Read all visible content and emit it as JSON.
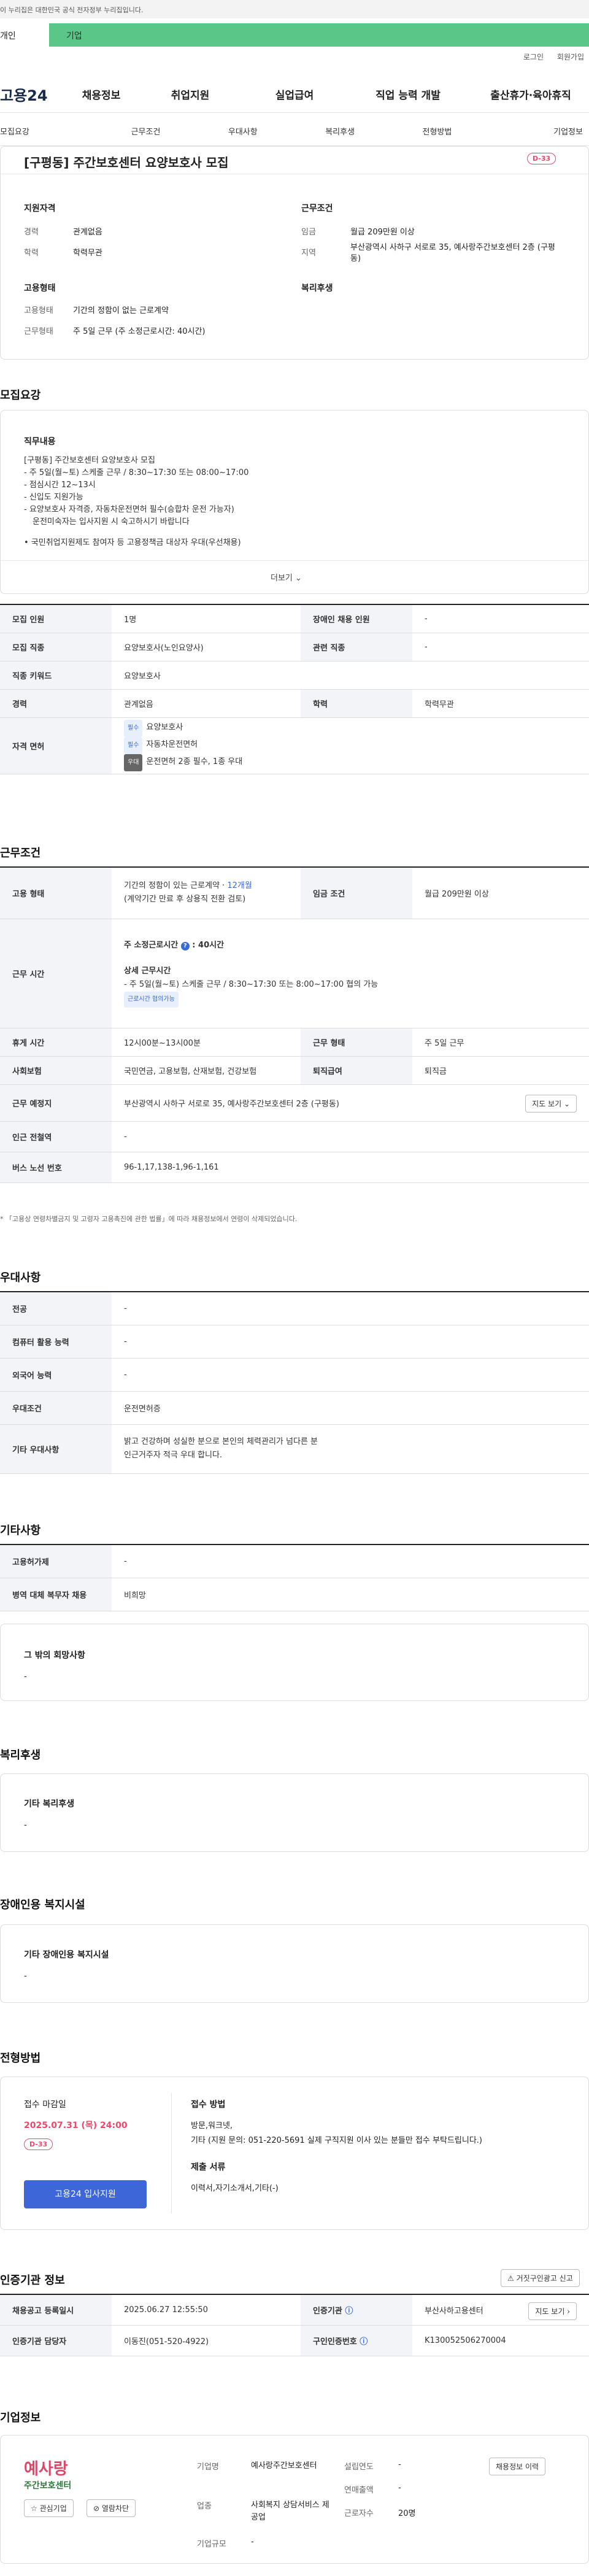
{
  "gov_banner": "이 누리집은 대한민국 공식 전자정부 누리집입니다.",
  "user_tabs": {
    "individual": "개인",
    "corporate": "기업"
  },
  "util_links": [
    "로그인",
    "회원가입"
  ],
  "logo": "고용24",
  "main_nav": [
    "채용정보",
    "취업지원",
    "실업급여",
    "직업 능력 개발",
    "출산휴가·육아휴직"
  ],
  "sub_tabs": [
    "모집요강",
    "근무조건",
    "우대사항",
    "복리후생",
    "전형방법",
    "기업정보"
  ],
  "job": {
    "title": "[구평동] 주간보호센터 요양보호사 모집",
    "dday": "D-33"
  },
  "summary": {
    "qual_title": "지원자격",
    "career_label": "경력",
    "career": "관계없음",
    "edu_label": "학력",
    "edu": "학력무관",
    "cond_title": "근무조건",
    "wage_label": "임금",
    "wage": "월급 209만원 이상",
    "loc_label": "지역",
    "loc": "부산광역시 사하구 서로로 35, 예사랑주간보호센터 2층 (구평동)",
    "emp_title": "고용형태",
    "emp_label": "고용형태",
    "emp": "기간의 정함이 없는 근로계약",
    "work_label": "근무형태",
    "work": "주 5일 근무 (주 소정근로시간: 40시간)",
    "welfare_title": "복리후생"
  },
  "recruit": {
    "h": "모집요강",
    "duty_title": "직무내용",
    "duty_lines": [
      "[구평동] 주간보호센터 요양보호사 모집",
      "- 주 5일(월~토) 스케줄 근무 / 8:30~17:30 또는 08:00~17:00",
      "- 점심시간 12~13시",
      "- 신입도 지원가능",
      "- 요양보호사 자격증, 자동차운전면허 필수(승합차 운전 가능자)",
      "  운전미숙자는 입사지원 시 숙고하시기 바랍니다",
      "",
      "• 국민취업지원제도 참여자 등 고용정책금 대상자 우대(우선채용)"
    ],
    "more": "더보기",
    "rows": [
      [
        "모집 인원",
        "1명",
        "장애인 채용 인원",
        "-"
      ],
      [
        "모집 직종",
        "요양보호사(노인요양사)",
        "관련 직종",
        "-"
      ],
      [
        "직종 키워드",
        "요양보호사"
      ],
      [
        "경력",
        "관계없음",
        "학력",
        "학력무관"
      ]
    ],
    "license_label": "자격 면허",
    "licenses": [
      [
        "필수",
        "요양보호사"
      ],
      [
        "필수",
        "자동차운전면허"
      ],
      [
        "우대",
        "운전면허 2종 필수, 1종 우대"
      ]
    ]
  },
  "workcond": {
    "h": "근무조건",
    "emp_label": "고용 형태",
    "emp_line1": "기간의 정함이 있는 근로계약 · ",
    "emp_months": "12개월",
    "emp_line2": "(계약기간 만료 후 상용직 전환 검토)",
    "wage_label": "임금 조건",
    "wage": "월급 209만원 이상",
    "time_label": "근무 시간",
    "time_week": "주 소정근로시간",
    "time_hours": "40시간",
    "time_detail_title": "상세 근무시간",
    "time_detail": "- 주 5일(월~토) 스케줄 근무 / 8:30~17:30 또는 8:00~17:00 협의 가능",
    "time_chip": "근로시간 협의가능",
    "break_label": "휴게 시간",
    "break": "12시00분~13시00분",
    "type_label": "근무 형태",
    "type": "주 5일 근무",
    "ins_label": "사회보험",
    "ins": "국민연금, 고용보험, 산재보험, 건강보험",
    "sev_label": "퇴직급여",
    "sev": "퇴직금",
    "place_label": "근무 예정지",
    "place": "부산광역시 사하구 서로로 35, 예사랑주간보호센터 2층 (구평동)",
    "map_btn": "지도 보기",
    "ind_label": "인근 전철역",
    "ind": "-",
    "bus_label": "버스 노선 번호",
    "bus": "96-1,17,138-1,96-1,161",
    "note": "* 「고용상 연령차별금지 및 고령자 고용촉진에 관한 법률」에 따라 채용정보에서 연령이 삭제되었습니다."
  },
  "pref": {
    "h": "우대사항",
    "rows": [
      [
        "전공",
        "-"
      ],
      [
        "컴퓨터 활용 능력",
        "-"
      ],
      [
        "외국어 능력",
        "-"
      ],
      [
        "우대조건",
        "운전면허증"
      ],
      [
        "기타 우대사항",
        "밝고 건강하며 성실한 분으로 본인의 체력관리가 넘다른 분",
        "인근거주자 적극 우대 합니다."
      ]
    ]
  },
  "etc": {
    "h": "기타사항",
    "rows": [
      [
        "고용허가제",
        "-"
      ],
      [
        "병역 대체 복무자 채용",
        "비희망"
      ]
    ],
    "other_title": "그 밖의 회망사항",
    "other": "-"
  },
  "welfare": {
    "h": "복리후생",
    "title": "기타 복리후생",
    "val": "-"
  },
  "disability": {
    "h": "장애인용 복지시설",
    "title": "기타 장애인용 복지시설",
    "val": "-"
  },
  "select": {
    "h": "전형방법",
    "deadline_title": "접수 마감일",
    "deadline": "2025.07.31 (목) 24:00",
    "dday": "D-33",
    "apply_btn": "고용24 입사지원",
    "method_title": "접수 방법",
    "method1": "방문,워크넷,",
    "method2": "기타 (지원 문의: 051-220-5691 실제 구직지원 이사 있는 분들만 접수 부탁드립니다.)",
    "docs_title": "제출 서류",
    "docs": "이력서,자기소개서,기타(-)"
  },
  "cert": {
    "h": "인증기관 정보",
    "fake_btn": "거짓구인광고 신고",
    "rows": [
      [
        "채용공고 등록일시",
        "2025.06.27 12:55:50",
        "인증기관",
        "부산사하고용센터"
      ],
      [
        "인증기관 담당자",
        "이동진(051-520-4922)",
        "구인인증번호",
        "K130052506270004"
      ]
    ],
    "map_btn": "지도 보기"
  },
  "company": {
    "h": "기업정보",
    "name_lbl": "기업명",
    "name": "예사랑주간보호센터",
    "year_lbl": "설립연도",
    "year": "-",
    "ind_lbl": "업종",
    "ind": "사회복지 상담서비스 제공업",
    "sales_lbl": "연매출액",
    "sales": "-",
    "emp_lbl": "근로자수",
    "emp": "20명",
    "size_lbl": "기업규모",
    "size": "-",
    "logo_top": "예사랑",
    "logo_bottom": "주간보호센터",
    "fav_btn": "관심기업",
    "block_btn": "열람차단",
    "jobs_btn": "채용정보 이력"
  }
}
